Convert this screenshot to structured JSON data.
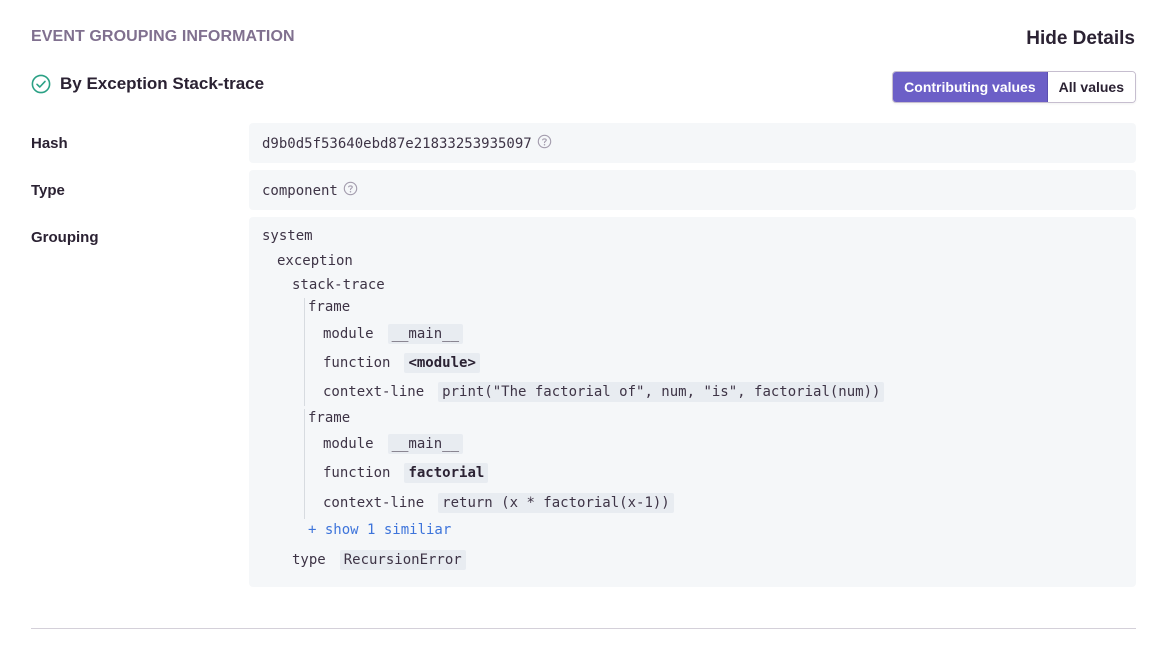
{
  "header": {
    "title": "EVENT GROUPING INFORMATION",
    "hide_details_label": "Hide Details"
  },
  "variant": {
    "label": "By Exception Stack-trace"
  },
  "toggle": {
    "contributing_label": "Contributing values",
    "all_label": "All values",
    "selected": "Contributing values"
  },
  "rows": {
    "hash": {
      "label": "Hash",
      "value": "d9b0d5f53640ebd87e21833253935097"
    },
    "type": {
      "label": "Type",
      "value": "component"
    },
    "grouping": {
      "label": "Grouping"
    }
  },
  "tree": {
    "system": "system",
    "exception": "exception",
    "stack_trace": "stack-trace",
    "frames": [
      {
        "label": "frame",
        "module_key": "module",
        "module_value": "__main__",
        "function_key": "function",
        "function_value": "<module>",
        "context_key": "context-line",
        "context_value": "print(\"The factorial of\", num, \"is\", factorial(num))"
      },
      {
        "label": "frame",
        "module_key": "module",
        "module_value": "__main__",
        "function_key": "function",
        "function_value": "factorial",
        "context_key": "context-line",
        "context_value": "return (x * factorial(x-1))"
      }
    ],
    "show_similar": "+ show 1 similiar",
    "type_key": "type",
    "type_value": "RecursionError"
  },
  "colors": {
    "accent": "#6c5fc7",
    "success": "#2ba185",
    "link": "#3d74db",
    "value_bg": "#f5f7f9"
  },
  "icons": {
    "variant_status": "check-circle-icon",
    "help": "question-circle-icon"
  }
}
